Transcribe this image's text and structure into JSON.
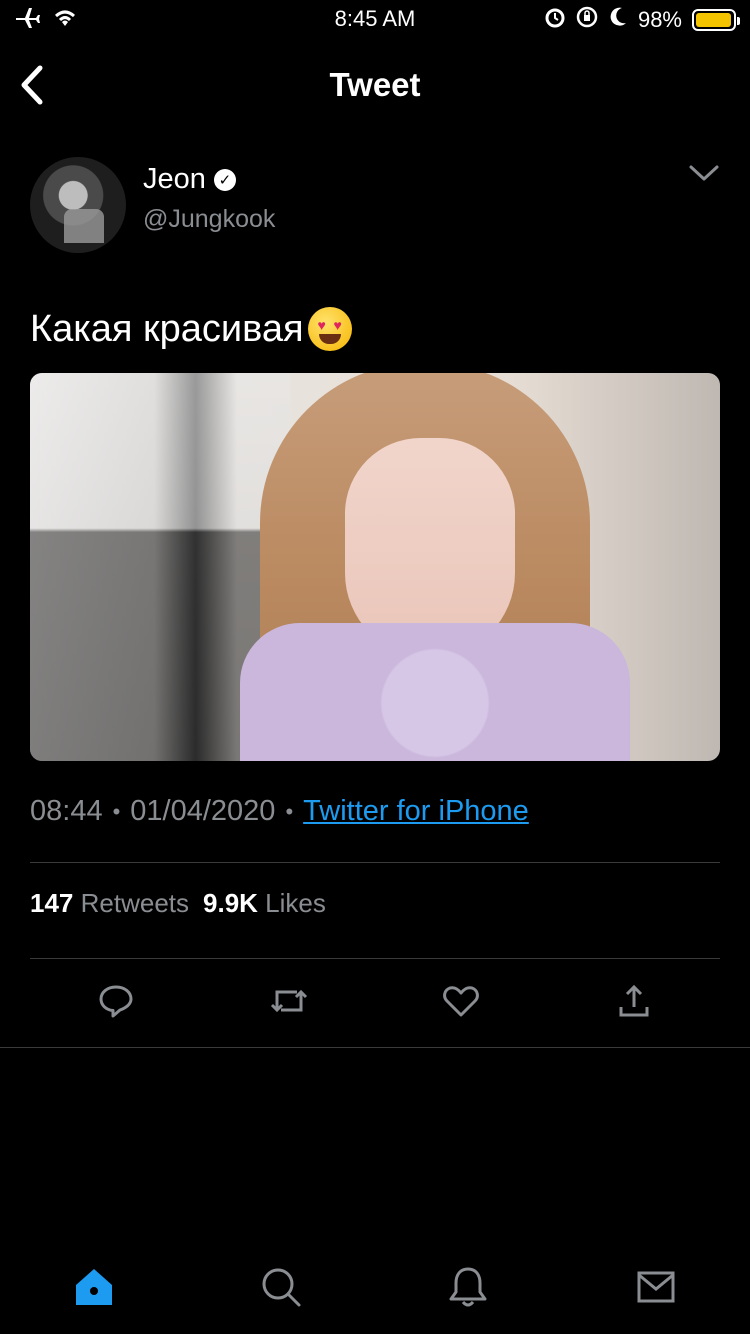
{
  "status_bar": {
    "time": "8:45 AM",
    "battery_percent": "98%",
    "battery_level": 0.98,
    "icons": [
      "airplane-icon",
      "wifi-icon",
      "alarm-icon",
      "rotation-lock-icon",
      "moon-icon",
      "battery-icon"
    ]
  },
  "navbar": {
    "title": "Tweet",
    "back_icon": "chevron-left-icon"
  },
  "tweet": {
    "author_name": "Jeon",
    "author_handle": "@Jungkook",
    "verified": true,
    "text": "Какая красивая",
    "emoji": "heart-eyes-emoji",
    "time": "08:44",
    "date": "01/04/2020",
    "source": "Twitter for iPhone",
    "retweets_count": "147",
    "retweets_label": "Retweets",
    "likes_count": "9.9K",
    "likes_label": "Likes"
  },
  "actions": [
    "reply-icon",
    "retweet-icon",
    "like-icon",
    "share-icon"
  ],
  "tabbar": {
    "tabs": [
      "home-icon",
      "search-icon",
      "notifications-icon",
      "messages-icon"
    ],
    "active": "home-icon",
    "accent": "#1d9bf0"
  }
}
